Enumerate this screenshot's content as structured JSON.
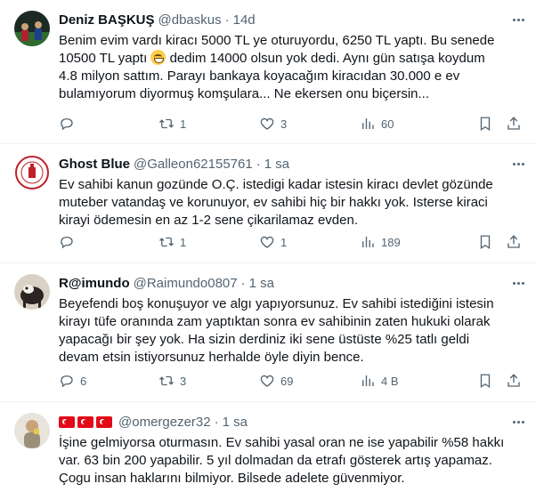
{
  "tweets": [
    {
      "name": "Deniz BAŞKUŞ",
      "handle": "@dbaskus",
      "dot": "·",
      "time": "14d",
      "lines": [
        "Benim evim vardı kiracı 5000 TL ye oturuyordu, 6250 TL yaptı. Bu senede",
        "10500 TL yaptı",
        " dedim 14000 olsun yok dedi. Aynı gün satışa koydum",
        "4.8 milyon sattım. Parayı bankaya koyacağım kiracıdan 30.000 e ev",
        "bulamıyorum diyormuş  komşulara...   Ne ekersen onu biçersin..."
      ],
      "replies": "",
      "retweets": "1",
      "likes": "3",
      "views": "60"
    },
    {
      "name": "Ghost Blue",
      "handle": "@Galleon62155761",
      "dot": "·",
      "time": "1 sa",
      "lines": [
        "Ev sahibi kanun gozünde O.Ç.  istedigi kadar istesin kiracı  devlet gözünde",
        "muteber vatandaş ve korunuyor, ev sahibi hiç bir hakkı yok. Isterse kiraci",
        "kirayi ödemesin en az 1-2 sene çikarilamaz evden."
      ],
      "replies": "",
      "retweets": "1",
      "likes": "1",
      "views": "189"
    },
    {
      "name": "R@imundo",
      "handle": "@Raimundo0807",
      "dot": "·",
      "time": "1 sa",
      "lines": [
        "Beyefendi boş konuşuyor ve algı yapıyorsunuz. Ev sahibi istediğini istesin",
        "kirayı tüfe oranında zam yaptıktan sonra ev sahibinin zaten hukuki olarak",
        "yapacağı bir şey yok. Ha sizin derdiniz iki sene üstüste %25 tatlı geldi",
        "devam etsin istiyorsunuz herhalde öyle diyin bence."
      ],
      "replies": "6",
      "retweets": "3",
      "likes": "69",
      "views": "4 B"
    },
    {
      "name": "",
      "handle": "@omergezer32",
      "dot": "·",
      "time": "1 sa",
      "lines": [
        "İşine gelmiyorsa oturmasın. Ev sahibi yasal oran ne ise yapabilir %58 hakkı",
        "var.  63 bin 200 yapabilir. 5 yıl dolmadan da etrafı gösterek artış yapamaz.",
        "Çogu insan haklarını bilmiyor. Bilsede adelete güvenmiyor."
      ]
    }
  ],
  "icons": {
    "reply": "reply-icon",
    "retweet": "retweet-icon",
    "like": "heart-icon",
    "views": "views-chart-icon",
    "bookmark": "bookmark-icon",
    "share": "share-icon",
    "more": "more-icon",
    "flag": "turkey-flag-icon",
    "emoji": "grinning-face-icon"
  },
  "colors": {
    "text": "#0f1419",
    "muted": "#536471",
    "divider": "#eff3f4",
    "flag_red": "#e30a17"
  }
}
